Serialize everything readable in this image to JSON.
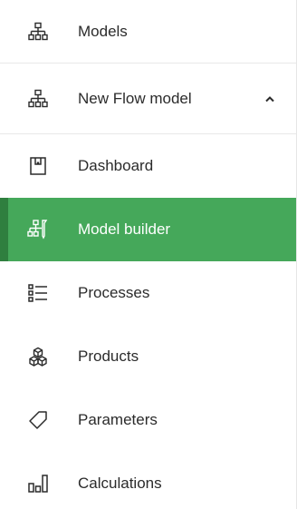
{
  "sidebar": {
    "models_label": "Models",
    "flow_model_label": "New Flow model",
    "items": [
      {
        "label": "Dashboard",
        "icon": "dashboard-icon"
      },
      {
        "label": "Model builder",
        "icon": "model-builder-icon",
        "active": true
      },
      {
        "label": "Processes",
        "icon": "processes-icon"
      },
      {
        "label": "Products",
        "icon": "products-icon"
      },
      {
        "label": "Parameters",
        "icon": "tag-icon"
      },
      {
        "label": "Calculations",
        "icon": "calculations-icon"
      }
    ]
  },
  "colors": {
    "active_bg": "#45a85a",
    "active_accent": "#2f7f3f",
    "text": "#2b2b2b"
  }
}
